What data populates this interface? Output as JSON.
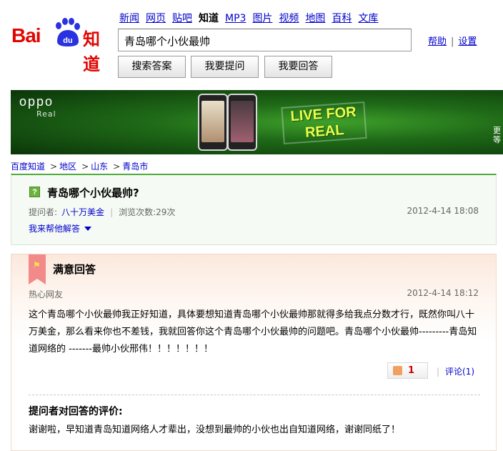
{
  "logo": {
    "bai": "Bai",
    "du": "du",
    "zhidao": "知道"
  },
  "nav": [
    "新闻",
    "网页",
    "贴吧",
    "知道",
    "MP3",
    "图片",
    "视频",
    "地图",
    "百科",
    "文库"
  ],
  "nav_active": "知道",
  "search": {
    "value": "青岛哪个小伙最帅"
  },
  "top_links": {
    "help": "帮助",
    "settings": "设置",
    "separator": "|"
  },
  "buttons": {
    "search": "搜索答案",
    "ask": "我要提问",
    "answer": "我要回答"
  },
  "banner": {
    "brand": "oppo",
    "model": "Real",
    "slogan_line1": "LIVE FOR",
    "slogan_line2": "REAL",
    "more": "更等"
  },
  "breadcrumb": {
    "items": [
      "百度知道",
      "地区",
      "山东",
      "青岛市"
    ],
    "sep": ">"
  },
  "question": {
    "icon": "?",
    "title": "青岛哪个小伙最帅?",
    "asker_label": "提问者:",
    "asker": "八十万美金",
    "views": "浏览次数:29次",
    "date": "2012-4-14 18:08",
    "help_label": "我来帮他解答"
  },
  "answer": {
    "title": "满意回答",
    "user": "热心网友",
    "date": "2012-4-14 18:12",
    "text": "这个青岛哪个小伙最帅我正好知道，具体要想知道青岛哪个小伙最帅那就得多给我点分数才行，既然你叫八十万美金，那么看来你也不差钱，我就回答你这个青岛哪个小伙最帅的问题吧。青岛哪个小伙最帅---------青岛知道网络的 -------最帅小伙邢伟！！！！！！！",
    "likes": "1",
    "comment": "评论(1)"
  },
  "evaluation": {
    "title": "提问者对回答的评价:",
    "text": "谢谢啦，早知道青岛知道网络人才辈出，没想到最帅的小伙也出自知道网络，谢谢同纸了！"
  }
}
